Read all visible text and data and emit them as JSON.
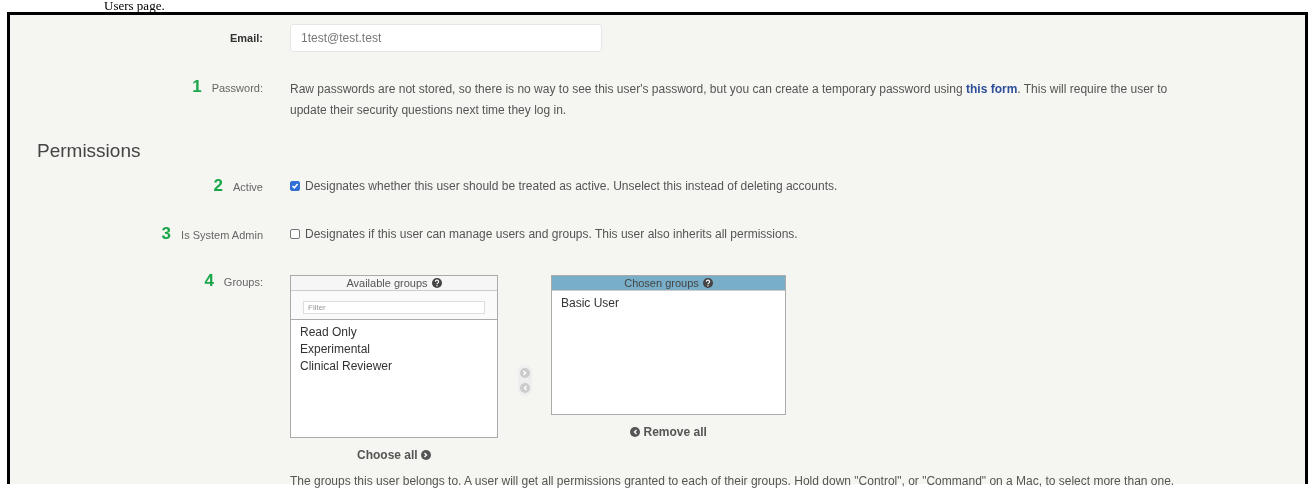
{
  "caption": "Users page.",
  "email": {
    "label": "Email:",
    "value": "1test@test.test"
  },
  "password": {
    "marker": "1",
    "label": "Password:",
    "text_before": "Raw passwords are not stored, so there is no way to see this user's password, but you can create a temporary password using ",
    "link": "this form",
    "text_after": ". This will require the user to update their security questions next time they log in."
  },
  "section_title": "Permissions",
  "flags": [
    {
      "marker": "2",
      "label": "Active",
      "checked": true,
      "help": "Designates whether this user should be treated as active. Unselect this instead of deleting accounts."
    },
    {
      "marker": "3",
      "label": "Is System Admin",
      "checked": false,
      "help": "Designates if this user can manage users and groups. This user also inherits all permissions."
    }
  ],
  "groups": {
    "marker": "4",
    "label": "Groups:",
    "available": {
      "title": "Available groups",
      "filter_placeholder": "Filter",
      "items": [
        "Read Only",
        "Experimental",
        "Clinical Reviewer"
      ],
      "action": "Choose all"
    },
    "chosen": {
      "title": "Chosen groups",
      "items": [
        "Basic User"
      ],
      "action": "Remove all"
    },
    "help": "The groups this user belongs to. A user will get all permissions granted to each of their groups. Hold down \"Control\", or \"Command\" on a Mac, to select more than one."
  }
}
